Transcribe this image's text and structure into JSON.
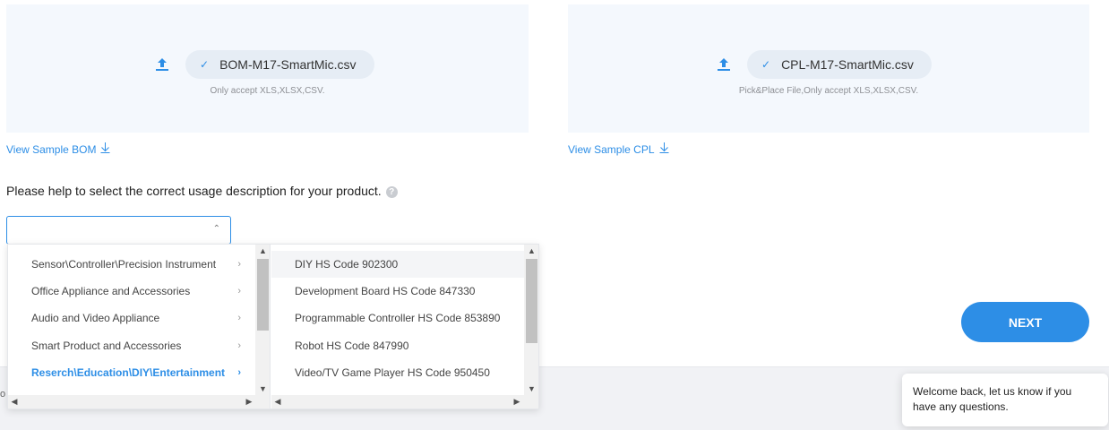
{
  "uploads": {
    "bom": {
      "file_name": "BOM-M17-SmartMic.csv",
      "hint": "Only accept XLS,XLSX,CSV.",
      "sample_link": "View Sample BOM"
    },
    "cpl": {
      "file_name": "CPL-M17-SmartMic.csv",
      "hint": "Pick&Place File,Only accept XLS,XLSX,CSV.",
      "sample_link": "View Sample CPL"
    }
  },
  "usage": {
    "question": "Please help to select the correct usage description for your product.",
    "help_icon": "?",
    "selected_value": ""
  },
  "cascader": {
    "categories": [
      {
        "label": "Sensor\\Controller\\Precision Instrument"
      },
      {
        "label": "Office Appliance and Accessories"
      },
      {
        "label": "Audio and Video Appliance"
      },
      {
        "label": "Smart Product and Accessories"
      },
      {
        "label": "Reserch\\Education\\DIY\\Entertainment",
        "active": true
      }
    ],
    "options": [
      {
        "label": "DIY HS Code 902300",
        "hover": true
      },
      {
        "label": "Development Board HS Code 847330"
      },
      {
        "label": "Programmable Controller HS Code 853890"
      },
      {
        "label": "Robot HS Code 847990"
      },
      {
        "label": "Video/TV Game Player HS Code 950450"
      }
    ]
  },
  "next_button": "NEXT",
  "footer_stub": "o",
  "chat": {
    "message": "Welcome back, let us know if you have any questions."
  },
  "colors": {
    "accent": "#2d8ee6",
    "upload_bg": "#f4f8fd",
    "pill_bg": "#e6edf5"
  },
  "icons": {
    "upload": "upload-icon",
    "check": "check-icon",
    "download": "download-icon",
    "chevron": "chevron-right-icon",
    "caret": "chevron-up-icon"
  }
}
